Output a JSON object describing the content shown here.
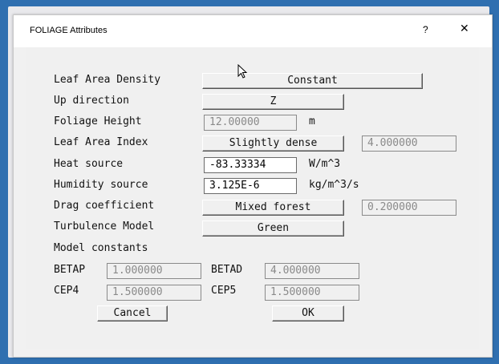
{
  "window": {
    "title": "FOLIAGE Attributes",
    "help_label": "?",
    "close_label": "✕"
  },
  "rows": {
    "leaf_area_density": {
      "label": "Leaf Area Density",
      "value": "Constant"
    },
    "up_direction": {
      "label": "Up direction",
      "value": "Z"
    },
    "foliage_height": {
      "label": "Foliage Height",
      "value": "12.00000",
      "unit": "m"
    },
    "leaf_area_index": {
      "label": "Leaf Area Index",
      "value": "Slightly dense",
      "number": "4.000000"
    },
    "heat_source": {
      "label": "Heat source",
      "value": "-83.33334",
      "unit": "W/m^3"
    },
    "humidity_source": {
      "label": "Humidity source",
      "value": "3.125E-6",
      "unit": "kg/m^3/s"
    },
    "drag_coefficient": {
      "label": "Drag coefficient",
      "value": "Mixed forest",
      "number": "0.200000"
    },
    "turbulence_model": {
      "label": "Turbulence Model",
      "value": "Green"
    }
  },
  "model_constants": {
    "heading": "Model constants",
    "betap": {
      "label": "BETAP",
      "value": "1.000000"
    },
    "betad": {
      "label": "BETAD",
      "value": "4.000000"
    },
    "cep4": {
      "label": "CEP4",
      "value": "1.500000"
    },
    "cep5": {
      "label": "CEP5",
      "value": "1.500000"
    }
  },
  "buttons": {
    "cancel": "Cancel",
    "ok": "OK"
  }
}
